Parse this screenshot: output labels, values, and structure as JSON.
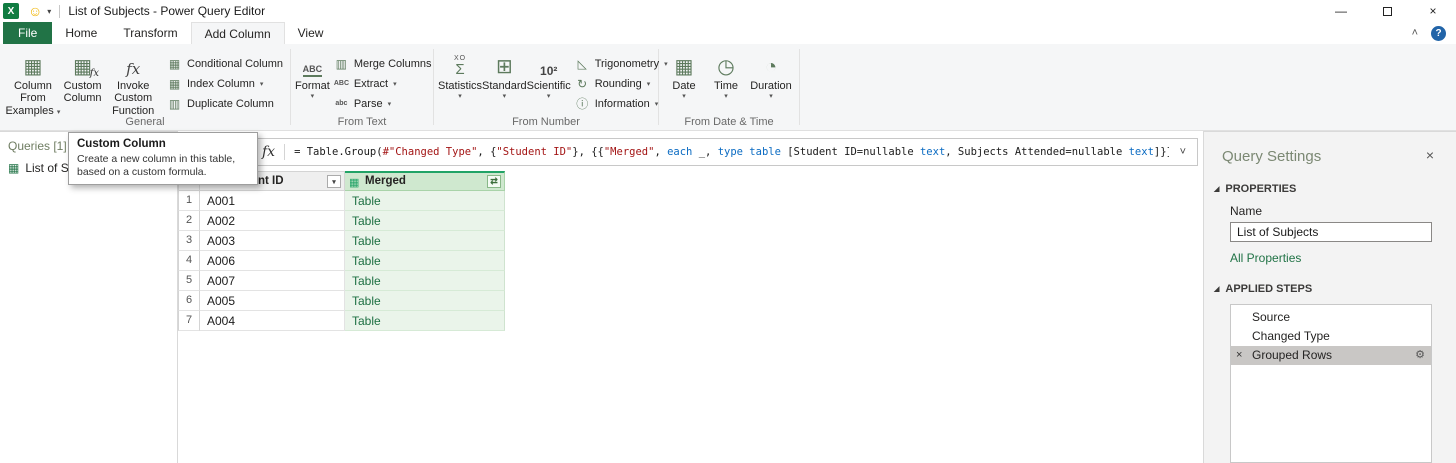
{
  "icons": {
    "app": "X",
    "smiley": "☺",
    "dropdown": "▾",
    "chevron_down": "˅",
    "chevron_up": "˄",
    "collapse_left": "˂",
    "minimize": "—",
    "close": "×",
    "help": "?",
    "table": "▦",
    "table_alt": "▥",
    "table_light": "▤",
    "fx": "fx",
    "xo": "XO",
    "sigma": "Σ",
    "grid": "⊞",
    "sci": "10²",
    "triangle": "◺",
    "rounding": "↻",
    "info": "ⓘ",
    "clock": "◷",
    "duration": "◔",
    "abc_upper": "ABC",
    "abc_lower": "abc",
    "expand": "⇄",
    "filter": "▾",
    "gear": "⚙",
    "section_marker": "◢"
  },
  "titlebar": {
    "title": "List of Subjects - Power Query Editor"
  },
  "tabs": {
    "file": "File",
    "home": "Home",
    "transform": "Transform",
    "add_column": "Add Column",
    "view": "View"
  },
  "ribbon": {
    "general": {
      "label": "General",
      "column_from_examples": "Column From Examples",
      "custom_column": "Custom Column",
      "invoke_custom_function": "Invoke Custom Function",
      "conditional_column": "Conditional Column",
      "index_column": "Index Column",
      "duplicate_column": "Duplicate Column"
    },
    "from_text": {
      "label": "From Text",
      "format": "Format",
      "merge_columns": "Merge Columns",
      "extract": "Extract",
      "parse": "Parse"
    },
    "from_number": {
      "label": "From Number",
      "statistics": "Statistics",
      "standard": "Standard",
      "scientific": "Scientific",
      "trigonometry": "Trigonometry",
      "rounding": "Rounding",
      "information": "Information"
    },
    "from_datetime": {
      "label": "From Date & Time",
      "date": "Date",
      "time": "Time",
      "duration": "Duration"
    }
  },
  "queries_pane": {
    "header": "Queries [1]",
    "item": "List of Subjects"
  },
  "formula_bar": {
    "segments": [
      {
        "text": "= Table.Group(",
        "type": "plain"
      },
      {
        "text": "#\"Changed Type\"",
        "type": "string"
      },
      {
        "text": ", {",
        "type": "plain"
      },
      {
        "text": "\"Student ID\"",
        "type": "string"
      },
      {
        "text": "}, {{",
        "type": "plain"
      },
      {
        "text": "\"Merged\"",
        "type": "string"
      },
      {
        "text": ", ",
        "type": "plain"
      },
      {
        "text": "each",
        "type": "keyword"
      },
      {
        "text": " _, ",
        "type": "plain"
      },
      {
        "text": "type table",
        "type": "keyword"
      },
      {
        "text": " [Student ID=nullable ",
        "type": "plain"
      },
      {
        "text": "text",
        "type": "keyword"
      },
      {
        "text": ", Subjects Attended=nullable ",
        "type": "plain"
      },
      {
        "text": "text",
        "type": "keyword"
      },
      {
        "text": "]}})",
        "type": "plain"
      }
    ]
  },
  "tooltip": {
    "title": "Custom Column",
    "body": "Create a new column in this table, based on a custom formula."
  },
  "grid": {
    "student_id_header": "Student ID",
    "merged_header": "Merged",
    "rows": [
      {
        "num": "1",
        "student_id": "A001",
        "merged": "Table"
      },
      {
        "num": "2",
        "student_id": "A002",
        "merged": "Table"
      },
      {
        "num": "3",
        "student_id": "A003",
        "merged": "Table"
      },
      {
        "num": "4",
        "student_id": "A006",
        "merged": "Table"
      },
      {
        "num": "5",
        "student_id": "A007",
        "merged": "Table"
      },
      {
        "num": "6",
        "student_id": "A005",
        "merged": "Table"
      },
      {
        "num": "7",
        "student_id": "A004",
        "merged": "Table"
      }
    ]
  },
  "query_settings": {
    "title": "Query Settings",
    "properties_header": "PROPERTIES",
    "name_label": "Name",
    "name_value": "List of Subjects",
    "all_properties": "All Properties",
    "applied_steps_header": "APPLIED STEPS",
    "steps": [
      {
        "label": "Source"
      },
      {
        "label": "Changed Type"
      },
      {
        "label": "Grouped Rows"
      }
    ]
  },
  "colors": {
    "excel_green": "#217346",
    "merged_accent": "#21a366",
    "string_red": "#a31515",
    "keyword_blue": "#0b6bc2"
  }
}
